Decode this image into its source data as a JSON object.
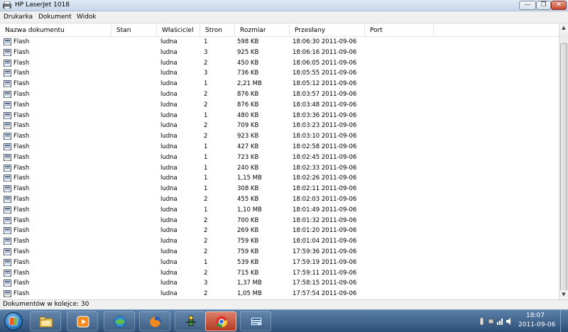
{
  "window": {
    "title": "HP LaserJet 1018",
    "controls": {
      "minimize": "—",
      "maximize": "❐",
      "close": "✕"
    }
  },
  "menu": [
    "Drukarka",
    "Dokument",
    "Widok"
  ],
  "columns": [
    "Nazwa dokumentu",
    "Stan",
    "Właściciel",
    "Stron",
    "Rozmiar",
    "Przesłany",
    "Port"
  ],
  "rows": [
    {
      "name": "Flash",
      "status": "",
      "owner": "ludna",
      "pages": "1",
      "size": "598 KB",
      "submitted": "18:06:30  2011-09-06",
      "port": ""
    },
    {
      "name": "Flash",
      "status": "",
      "owner": "ludna",
      "pages": "3",
      "size": "925 KB",
      "submitted": "18:06:16  2011-09-06",
      "port": ""
    },
    {
      "name": "Flash",
      "status": "",
      "owner": "ludna",
      "pages": "2",
      "size": "450 KB",
      "submitted": "18:06:05  2011-09-06",
      "port": ""
    },
    {
      "name": "Flash",
      "status": "",
      "owner": "ludna",
      "pages": "3",
      "size": "736 KB",
      "submitted": "18:05:55  2011-09-06",
      "port": ""
    },
    {
      "name": "Flash",
      "status": "",
      "owner": "ludna",
      "pages": "1",
      "size": "2,21 MB",
      "submitted": "18:05:12  2011-09-06",
      "port": ""
    },
    {
      "name": "Flash",
      "status": "",
      "owner": "ludna",
      "pages": "2",
      "size": "876 KB",
      "submitted": "18:03:57  2011-09-06",
      "port": ""
    },
    {
      "name": "Flash",
      "status": "",
      "owner": "ludna",
      "pages": "2",
      "size": "876 KB",
      "submitted": "18:03:48  2011-09-06",
      "port": ""
    },
    {
      "name": "Flash",
      "status": "",
      "owner": "ludna",
      "pages": "1",
      "size": "480 KB",
      "submitted": "18:03:36  2011-09-06",
      "port": ""
    },
    {
      "name": "Flash",
      "status": "",
      "owner": "ludna",
      "pages": "2",
      "size": "709 KB",
      "submitted": "18:03:23  2011-09-06",
      "port": ""
    },
    {
      "name": "Flash",
      "status": "",
      "owner": "ludna",
      "pages": "2",
      "size": "923 KB",
      "submitted": "18:03:10  2011-09-06",
      "port": ""
    },
    {
      "name": "Flash",
      "status": "",
      "owner": "ludna",
      "pages": "1",
      "size": "427 KB",
      "submitted": "18:02:58  2011-09-06",
      "port": ""
    },
    {
      "name": "Flash",
      "status": "",
      "owner": "ludna",
      "pages": "1",
      "size": "723 KB",
      "submitted": "18:02:45  2011-09-06",
      "port": ""
    },
    {
      "name": "Flash",
      "status": "",
      "owner": "ludna",
      "pages": "1",
      "size": "240 KB",
      "submitted": "18:02:33  2011-09-06",
      "port": ""
    },
    {
      "name": "Flash",
      "status": "",
      "owner": "ludna",
      "pages": "1",
      "size": "1,15 MB",
      "submitted": "18:02:26  2011-09-06",
      "port": ""
    },
    {
      "name": "Flash",
      "status": "",
      "owner": "ludna",
      "pages": "1",
      "size": "308 KB",
      "submitted": "18:02:11  2011-09-06",
      "port": ""
    },
    {
      "name": "Flash",
      "status": "",
      "owner": "ludna",
      "pages": "2",
      "size": "455 KB",
      "submitted": "18:02:03  2011-09-06",
      "port": ""
    },
    {
      "name": "Flash",
      "status": "",
      "owner": "ludna",
      "pages": "1",
      "size": "1,10 MB",
      "submitted": "18:01:49  2011-09-06",
      "port": ""
    },
    {
      "name": "Flash",
      "status": "",
      "owner": "ludna",
      "pages": "2",
      "size": "700 KB",
      "submitted": "18:01:32  2011-09-06",
      "port": ""
    },
    {
      "name": "Flash",
      "status": "",
      "owner": "ludna",
      "pages": "2",
      "size": "269 KB",
      "submitted": "18:01:20  2011-09-06",
      "port": ""
    },
    {
      "name": "Flash",
      "status": "",
      "owner": "ludna",
      "pages": "2",
      "size": "759 KB",
      "submitted": "18:01:04  2011-09-06",
      "port": ""
    },
    {
      "name": "Flash",
      "status": "",
      "owner": "ludna",
      "pages": "2",
      "size": "759 KB",
      "submitted": "17:59:36  2011-09-06",
      "port": ""
    },
    {
      "name": "Flash",
      "status": "",
      "owner": "ludna",
      "pages": "1",
      "size": "539 KB",
      "submitted": "17:59:19  2011-09-06",
      "port": ""
    },
    {
      "name": "Flash",
      "status": "",
      "owner": "ludna",
      "pages": "2",
      "size": "715 KB",
      "submitted": "17:59:11  2011-09-06",
      "port": ""
    },
    {
      "name": "Flash",
      "status": "",
      "owner": "ludna",
      "pages": "3",
      "size": "1,37 MB",
      "submitted": "17:58:15  2011-09-06",
      "port": ""
    },
    {
      "name": "Flash",
      "status": "",
      "owner": "ludna",
      "pages": "2",
      "size": "1,05 MB",
      "submitted": "17:57:54  2011-09-06",
      "port": ""
    }
  ],
  "status": "Dokumentów w kolejce: 30",
  "taskbar": {
    "apps": [
      "explorer-icon",
      "media-player-icon",
      "network-globe-icon",
      "firefox-icon",
      "app-figure-icon",
      "chrome-icon",
      "printer-queue-icon"
    ],
    "clock_time": "18:07",
    "clock_date": "2011-09-06"
  },
  "colors": {
    "taskbar": "#3a6290",
    "active_task": "#c4513a",
    "titlebar": "#d3e0ef"
  }
}
